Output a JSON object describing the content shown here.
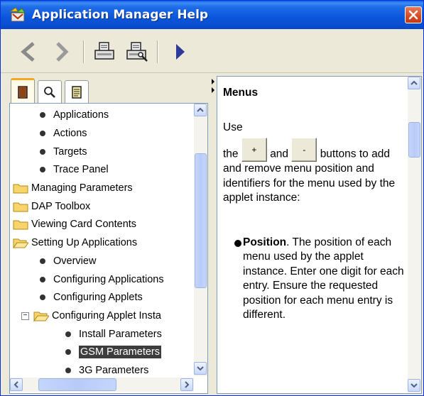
{
  "window": {
    "title": "Application Manager Help",
    "title_bar_color": "#0a56db",
    "close_button_color": "#d54a24"
  },
  "toolbar": {
    "buttons": [
      {
        "name": "back-button",
        "icon": "arrow-left-icon"
      },
      {
        "name": "forward-button",
        "icon": "arrow-right-icon"
      },
      {
        "name": "print-button",
        "icon": "printer-icon"
      },
      {
        "name": "print-setup-button",
        "icon": "printer-settings-icon"
      },
      {
        "name": "show-hide-button",
        "icon": "triangle-right-icon"
      }
    ]
  },
  "nav": {
    "tabs": [
      {
        "name": "contents",
        "icon": "book-icon",
        "active": true
      },
      {
        "name": "search",
        "icon": "magnifier-icon",
        "active": false
      },
      {
        "name": "index",
        "icon": "document-icon",
        "active": false
      }
    ],
    "tree": [
      {
        "label": "Applications",
        "type": "topic",
        "level": 1
      },
      {
        "label": "Actions",
        "type": "topic",
        "level": 1
      },
      {
        "label": "Targets",
        "type": "topic",
        "level": 1
      },
      {
        "label": "Trace Panel",
        "type": "topic",
        "level": 1
      },
      {
        "label": "Managing Parameters",
        "type": "folder",
        "level": 0
      },
      {
        "label": "DAP Toolbox",
        "type": "folder",
        "level": 0
      },
      {
        "label": "Viewing Card Contents",
        "type": "folder",
        "level": 0
      },
      {
        "label": "Setting Up Applications",
        "type": "folder-open",
        "level": 0
      },
      {
        "label": "Overview",
        "type": "topic",
        "level": 1
      },
      {
        "label": "Configuring Applications",
        "type": "topic",
        "level": 1
      },
      {
        "label": "Configuring Applets",
        "type": "topic",
        "level": 1
      },
      {
        "label": "Configuring Applet Insta",
        "type": "folder-open",
        "level": 1,
        "expander": "−"
      },
      {
        "label": "Install Parameters",
        "type": "topic",
        "level": 2
      },
      {
        "label": "GSM Parameters",
        "type": "topic",
        "level": 2,
        "selected": true
      },
      {
        "label": "3G Parameters",
        "type": "topic",
        "level": 2
      }
    ],
    "selection_color": "#3d3d3d"
  },
  "content": {
    "heading": "Menus",
    "intro_use": "Use",
    "intro_the": "the",
    "plus_label": "+",
    "and_word": "and",
    "minus_label": "-",
    "buttons_word": "buttons",
    "intro_rest": "to add and remove menu position and identifiers for the menu used by the applet instance:",
    "bullet_term": "Position",
    "bullet_text": ". The position of each menu used by the applet instance. Enter one digit for each entry. Ensure the requested position for each menu entry is different."
  }
}
